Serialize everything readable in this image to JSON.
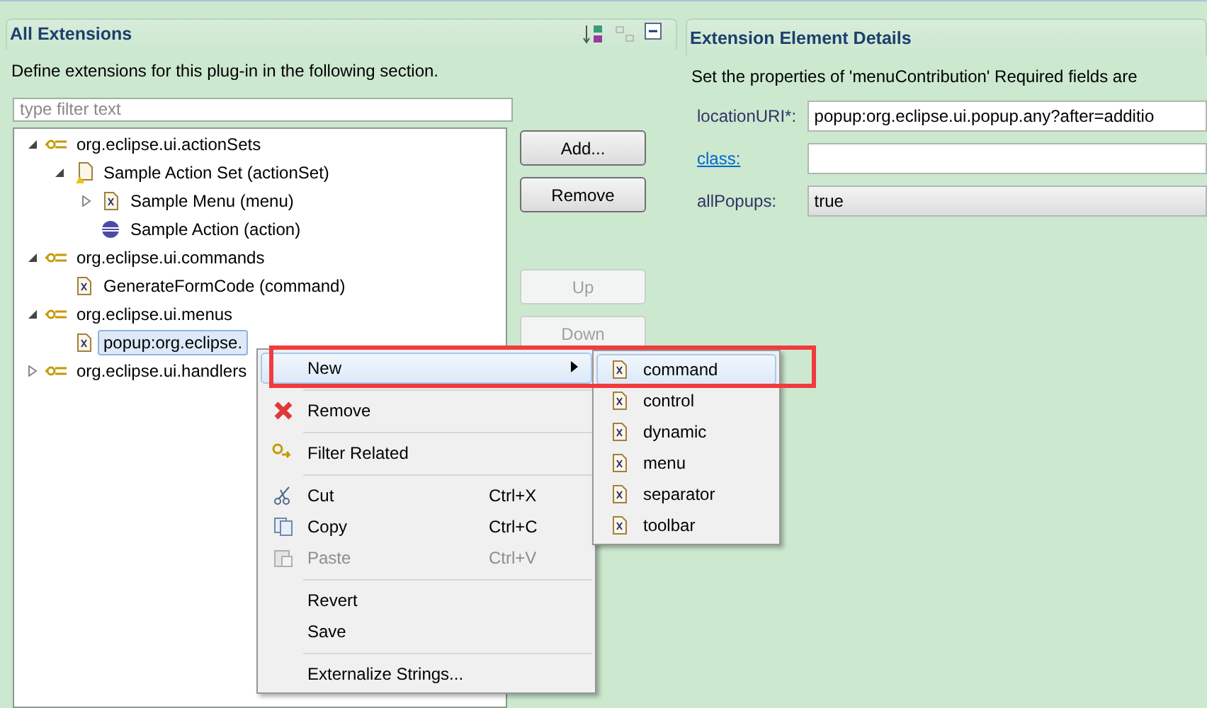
{
  "left_section": {
    "title": "All Extensions",
    "description": "Define extensions for this plug-in in the following section.",
    "filter": {
      "placeholder": "type filter text"
    },
    "tree": [
      {
        "label": "org.eclipse.ui.actionSets",
        "kind": "point",
        "expanded": true,
        "selected": false,
        "children": [
          {
            "label": "Sample Action Set (actionSet)",
            "kind": "warn",
            "expanded": true,
            "selected": false,
            "children": [
              {
                "label": "Sample Menu (menu)",
                "kind": "element",
                "expanded": false,
                "selected": false
              },
              {
                "label": "Sample Action (action)",
                "kind": "action",
                "selected": false
              }
            ]
          }
        ]
      },
      {
        "label": "org.eclipse.ui.commands",
        "kind": "point",
        "expanded": true,
        "selected": false,
        "children": [
          {
            "label": "GenerateFormCode (command)",
            "kind": "element",
            "selected": false
          }
        ]
      },
      {
        "label": "org.eclipse.ui.menus",
        "kind": "point",
        "expanded": true,
        "selected": false,
        "children": [
          {
            "label": "popup:org.eclipse.",
            "kind": "element",
            "selected": true
          }
        ]
      },
      {
        "label": "org.eclipse.ui.handlers",
        "kind": "point",
        "expanded": false,
        "selected": false
      }
    ],
    "buttons": [
      {
        "label": "Add...",
        "disabled": false
      },
      {
        "label": "Remove",
        "disabled": false
      },
      {
        "label": "Up",
        "disabled": true
      },
      {
        "label": "Down",
        "disabled": true
      }
    ]
  },
  "right_section": {
    "title": "Extension Element Details",
    "description": "Set the properties of 'menuContribution' Required fields are",
    "fields": [
      {
        "label": "locationURI*:",
        "kind": "text",
        "link": false,
        "value": "popup:org.eclipse.ui.popup.any?after=additio"
      },
      {
        "label": "class:",
        "kind": "text",
        "link": true
      },
      {
        "label": "allPopups:",
        "kind": "combo",
        "link": false,
        "value": "true"
      }
    ]
  },
  "context_menu": {
    "items": [
      {
        "label": "New",
        "submenu": true,
        "disabled": false,
        "selected": true
      },
      {
        "label": "Remove",
        "submenu": false,
        "disabled": false,
        "selected": false
      },
      {
        "label": "Filter Related",
        "submenu": false,
        "disabled": false,
        "selected": false
      },
      {
        "label": "Cut",
        "shortcut": "Ctrl+X",
        "submenu": false,
        "disabled": false,
        "selected": false
      },
      {
        "label": "Copy",
        "shortcut": "Ctrl+C",
        "submenu": false,
        "disabled": false,
        "selected": false
      },
      {
        "label": "Paste",
        "shortcut": "Ctrl+V",
        "submenu": false,
        "disabled": true,
        "selected": false
      },
      {
        "label": "Revert",
        "submenu": false,
        "disabled": false,
        "selected": false
      },
      {
        "label": "Save",
        "submenu": false,
        "disabled": false,
        "selected": false
      },
      {
        "label": "Externalize Strings...",
        "submenu": false,
        "disabled": false,
        "selected": false
      }
    ]
  },
  "submenu": {
    "items": [
      {
        "label": "command",
        "selected": true
      },
      {
        "label": "control",
        "selected": false
      },
      {
        "label": "dynamic",
        "selected": false
      },
      {
        "label": "menu",
        "selected": false
      },
      {
        "label": "separator",
        "selected": false
      },
      {
        "label": "toolbar",
        "selected": false
      }
    ]
  }
}
